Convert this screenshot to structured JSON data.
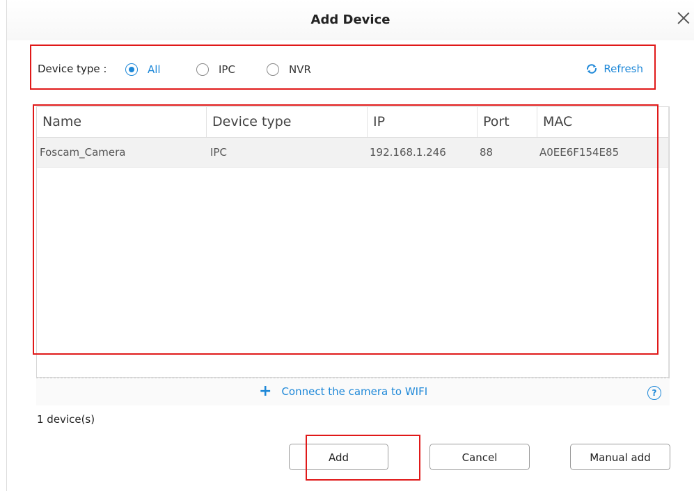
{
  "dialog": {
    "title": "Add Device"
  },
  "filter": {
    "label": "Device type :",
    "options": [
      {
        "label": "All",
        "selected": true
      },
      {
        "label": "IPC",
        "selected": false
      },
      {
        "label": "NVR",
        "selected": false
      }
    ],
    "refresh_label": "Refresh"
  },
  "table": {
    "columns": [
      "Name",
      "Device type",
      "IP",
      "Port",
      "MAC"
    ],
    "rows": [
      [
        "Foscam_Camera",
        "IPC",
        "192.168.1.246",
        "88",
        "A0EE6F154E85"
      ]
    ]
  },
  "wifi": {
    "label": "Connect the camera to WIFI"
  },
  "status": {
    "count": "1 device(s)"
  },
  "buttons": {
    "add": "Add",
    "cancel": "Cancel",
    "manual_add": "Manual add"
  },
  "colors": {
    "accent": "#1e88d8",
    "highlight_box": "#e01919"
  }
}
